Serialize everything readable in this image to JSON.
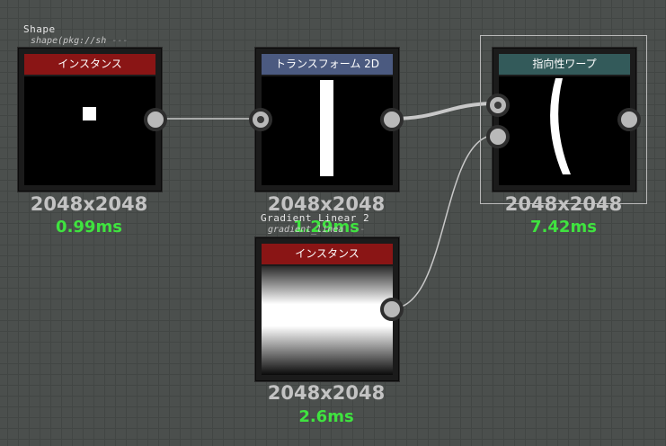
{
  "colors": {
    "background": "#4b4f4d",
    "grid_line": "#424644",
    "title_instance": "#8a1515",
    "title_transform": "#4b5a80",
    "title_warp": "#335a5a",
    "timing": "#3fe33f",
    "resolution": "#c3c3c3",
    "wire": "#c8c8c8",
    "selection": "#b8b8b8"
  },
  "frames": {
    "shape": {
      "label": "Shape",
      "sublabel": "shape(pkg://sh"
    },
    "gradient": {
      "label": "Gradient Linear 2",
      "sublabel": "gradient_linea"
    }
  },
  "nodes": {
    "shape_instance": {
      "title": "インスタンス",
      "resolution": "2048x2048",
      "timing": "0.99ms"
    },
    "transform_2d": {
      "title": "トランスフォーム 2D",
      "resolution": "2048x2048",
      "timing": "1.29ms"
    },
    "directional_warp": {
      "title": "指向性ワープ",
      "resolution": "2048x2048",
      "timing": "7.42ms",
      "selected": true
    },
    "gradient_instance": {
      "title": "インスタンス",
      "resolution": "2048x2048",
      "timing": "2.6ms"
    }
  },
  "icons": {
    "input_pin": "input-pin-icon",
    "output_pin": "output-pin-icon"
  }
}
